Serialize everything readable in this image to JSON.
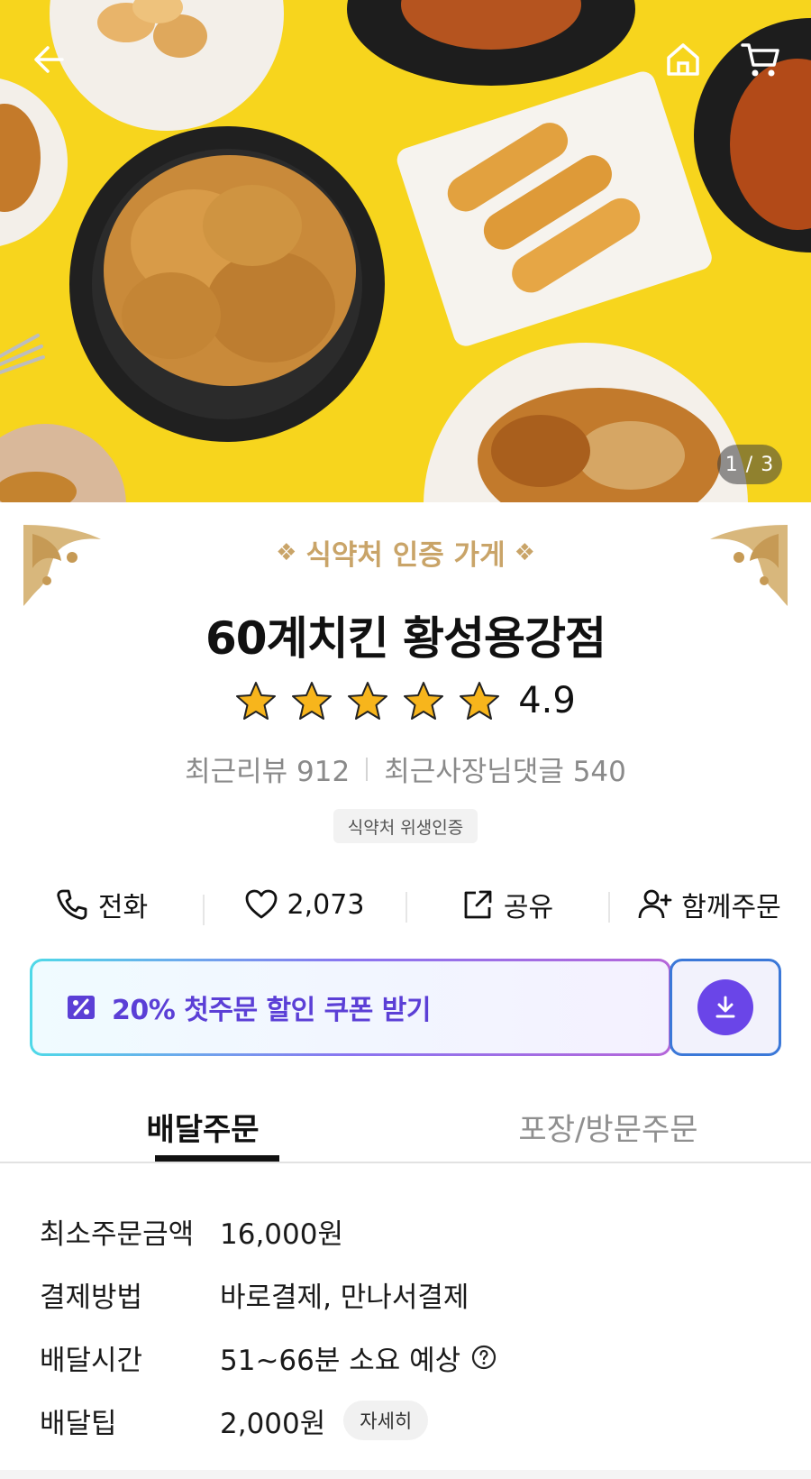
{
  "hero": {
    "image_counter": "1 / 3"
  },
  "certification": {
    "title": "식약처 인증 가게"
  },
  "store": {
    "name": "60계치킨 황성용강점",
    "rating": "4.9",
    "stars": 5,
    "recent_reviews": "최근리뷰 912",
    "owner_replies": "최근사장님댓글 540",
    "hygiene_badge": "식약처 위생인증"
  },
  "actions": {
    "call": "전화",
    "likes": "2,073",
    "share": "공유",
    "group_order": "함께주문"
  },
  "coupon": {
    "text": "20% 첫주문 할인 쿠폰 받기"
  },
  "tabs": [
    {
      "label": "배달주문",
      "active": true
    },
    {
      "label": "포장/방문주문",
      "active": false
    }
  ],
  "details": {
    "min_order_label": "최소주문금액",
    "min_order_value": "16,000원",
    "payment_label": "결제방법",
    "payment_value": "바로결제, 만나서결제",
    "delivery_time_label": "배달시간",
    "delivery_time_value": "51~66분 소요 예상",
    "delivery_tip_label": "배달팁",
    "delivery_tip_value": "2,000원",
    "detail_button": "자세히"
  },
  "colors": {
    "hero_background": "#f7d51d",
    "certification_gold": "#c9a468",
    "coupon_text": "#5b3fd6",
    "coupon_button": "#6a45e8"
  }
}
